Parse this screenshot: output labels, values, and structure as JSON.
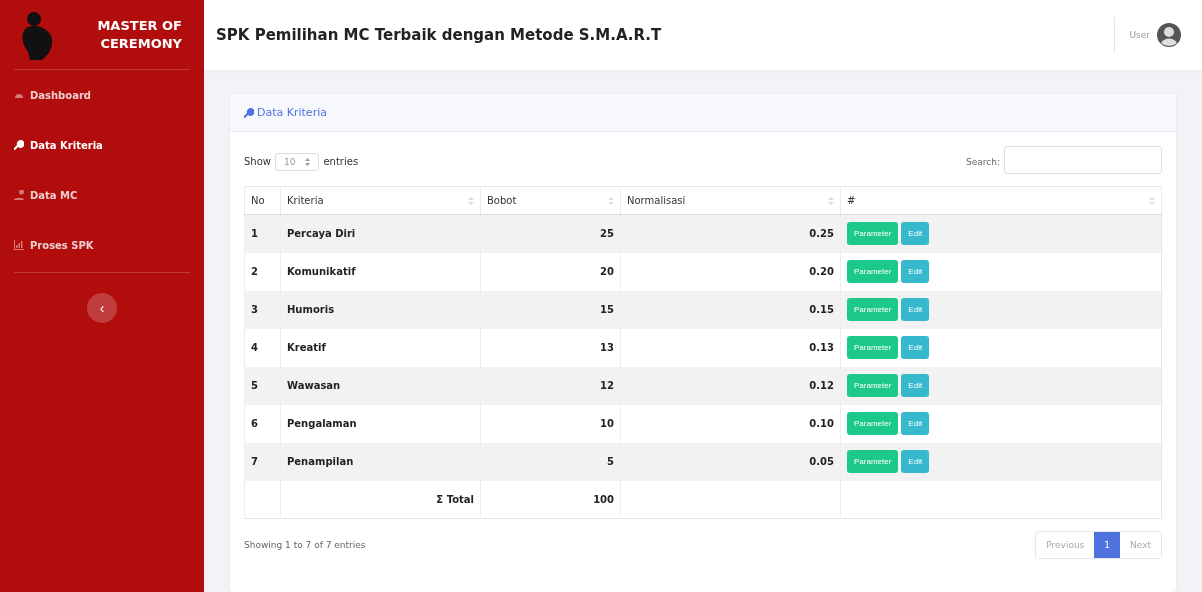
{
  "sidebar": {
    "brand": "MASTER OF CEREMONY",
    "items": [
      {
        "label": "Dashboard",
        "selected": false
      },
      {
        "label": "Data Kriteria",
        "selected": true
      },
      {
        "label": "Data MC",
        "selected": false
      },
      {
        "label": "Proses SPK",
        "selected": false
      }
    ],
    "toggle": "‹"
  },
  "topbar": {
    "title": "SPK Pemilihan MC Terbaik dengan Metode S.M.A.R.T",
    "user": "User"
  },
  "card": {
    "title": "Data Kriteria",
    "length": {
      "show": "Show",
      "value": "10",
      "entries": "entries"
    },
    "search": {
      "label": "Search:"
    },
    "table": {
      "columns": [
        "No",
        "Kriteria",
        "Bobot",
        "Normalisasi",
        "#"
      ],
      "rows": [
        {
          "no": "1",
          "kriteria": "Percaya Diri",
          "bobot": "25",
          "normalisasi": "0.25",
          "actions": [
            "Parameter",
            "Edit"
          ]
        },
        {
          "no": "2",
          "kriteria": "Komunikatif",
          "bobot": "20",
          "normalisasi": "0.20",
          "actions": [
            "Parameter",
            "Edit"
          ]
        },
        {
          "no": "3",
          "kriteria": "Humoris",
          "bobot": "15",
          "normalisasi": "0.15",
          "actions": [
            "Parameter",
            "Edit"
          ]
        },
        {
          "no": "4",
          "kriteria": "Kreatif",
          "bobot": "13",
          "normalisasi": "0.13",
          "actions": [
            "Parameter",
            "Edit"
          ]
        },
        {
          "no": "5",
          "kriteria": "Wawasan",
          "bobot": "12",
          "normalisasi": "0.12",
          "actions": [
            "Parameter",
            "Edit"
          ]
        },
        {
          "no": "6",
          "kriteria": "Pengalaman",
          "bobot": "10",
          "normalisasi": "0.10",
          "actions": [
            "Parameter",
            "Edit"
          ]
        },
        {
          "no": "7",
          "kriteria": "Penampilan",
          "bobot": "5",
          "normalisasi": "0.05",
          "actions": [
            "Parameter",
            "Edit"
          ]
        }
      ],
      "total": {
        "label": "Σ Total",
        "value": "100"
      }
    },
    "info": "Showing 1 to 7 of 7 entries",
    "pagination": [
      {
        "label": "Previous",
        "selected": false
      },
      {
        "label": "1",
        "selected": true
      },
      {
        "label": "Next",
        "selected": false
      }
    ]
  }
}
